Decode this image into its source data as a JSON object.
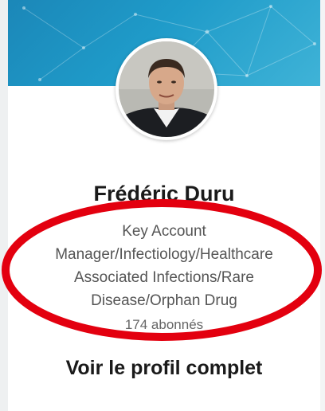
{
  "profile": {
    "name": "Frédéric Duru",
    "headline_lines": [
      "Key Account",
      "Manager/Infectiology/Healthcare",
      "Associated Infections/Rare",
      "Disease/Orphan Drug"
    ],
    "followers": "174 abonnés",
    "view_profile_label": "Voir le profil complet"
  },
  "colors": {
    "banner": "#1f9bc9",
    "annotation_ring": "#e3000f"
  },
  "icons": {
    "avatar": "profile-photo"
  }
}
